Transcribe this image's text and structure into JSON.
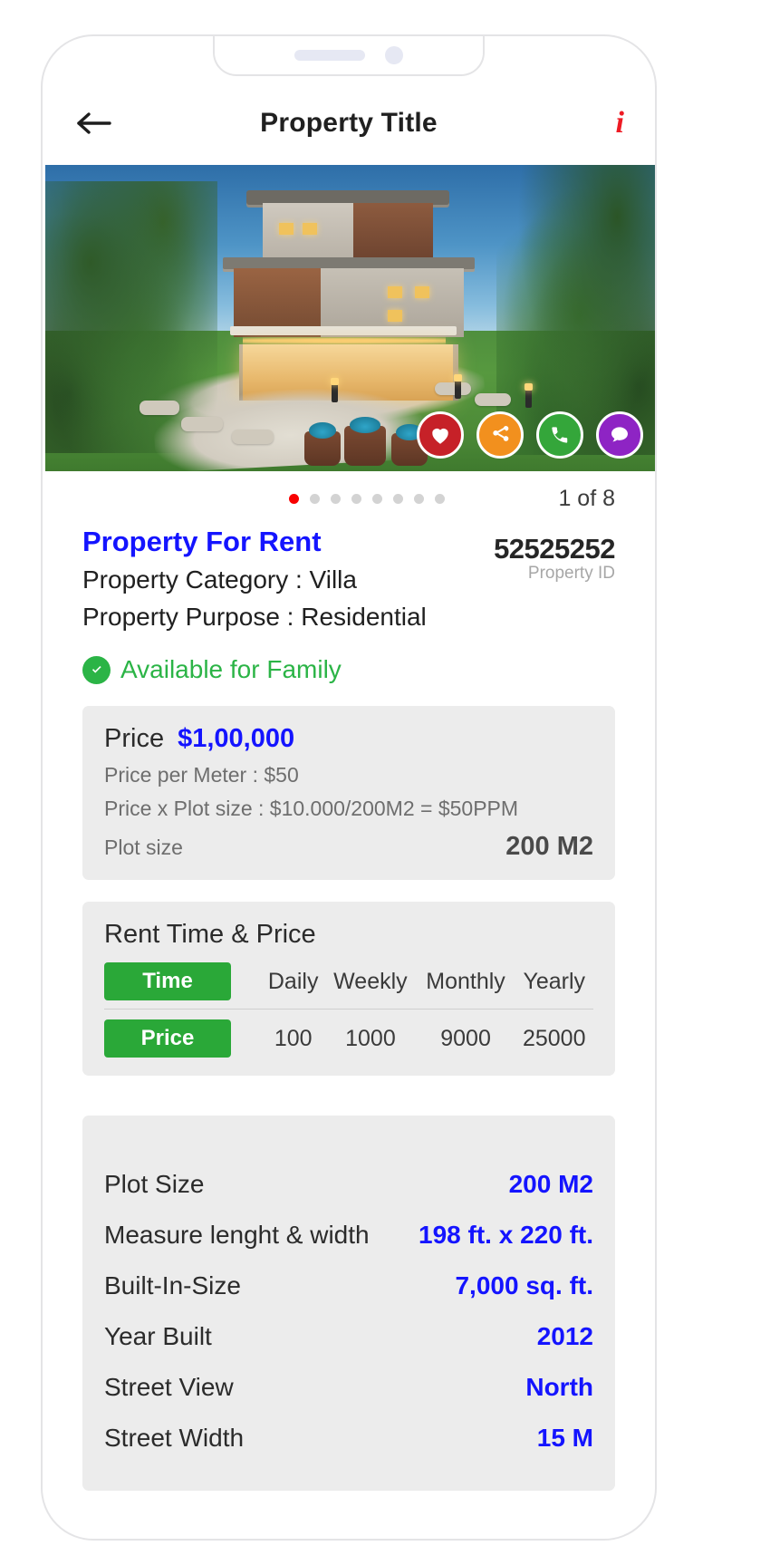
{
  "header": {
    "title": "Property Title",
    "back_label": "Back",
    "info_label": "i"
  },
  "gallery": {
    "counter": "1 of 8",
    "total_dots": 8,
    "active_index": 0,
    "actions": [
      {
        "name": "favorite",
        "icon": "heart-icon",
        "color": "#c62128"
      },
      {
        "name": "share",
        "icon": "share-icon",
        "color": "#f2901e"
      },
      {
        "name": "call",
        "icon": "phone-icon",
        "color": "#34a63a"
      },
      {
        "name": "chat",
        "icon": "chat-icon",
        "color": "#8e24c4"
      }
    ]
  },
  "overview": {
    "for_rent": "Property For Rent",
    "category": "Property Category : Villa",
    "purpose": "Property Purpose : Residential",
    "property_id": "52525252",
    "property_id_label": "Property ID",
    "availability": "Available for Family"
  },
  "price": {
    "label": "Price",
    "value": "$1,00,000",
    "per_meter": "Price per Meter : $50",
    "calculation": "Price x Plot size : $10.000/200M2 = $50PPM",
    "plot_size_label": "Plot size",
    "plot_size_value": "200 M2"
  },
  "rent": {
    "title": "Rent Time & Price",
    "time_tag": "Time",
    "price_tag": "Price",
    "periods": [
      "Daily",
      "Weekly",
      "Monthly",
      "Yearly"
    ],
    "prices": [
      "100",
      "1000",
      "9000",
      "25000"
    ]
  },
  "specs": [
    {
      "label": "Plot Size",
      "value": "200 M2"
    },
    {
      "label": "Measure lenght & width",
      "value": "198 ft. x 220 ft."
    },
    {
      "label": "Built-In-Size",
      "value": "7,000 sq. ft."
    },
    {
      "label": "Year Built",
      "value": "2012"
    },
    {
      "label": "Street View",
      "value": "North"
    },
    {
      "label": "Street Width",
      "value": "15 M"
    }
  ],
  "colors": {
    "accent_blue": "#1414ff",
    "green": "#2bb446",
    "red": "#ee1b24",
    "panel_bg": "#ececec"
  }
}
